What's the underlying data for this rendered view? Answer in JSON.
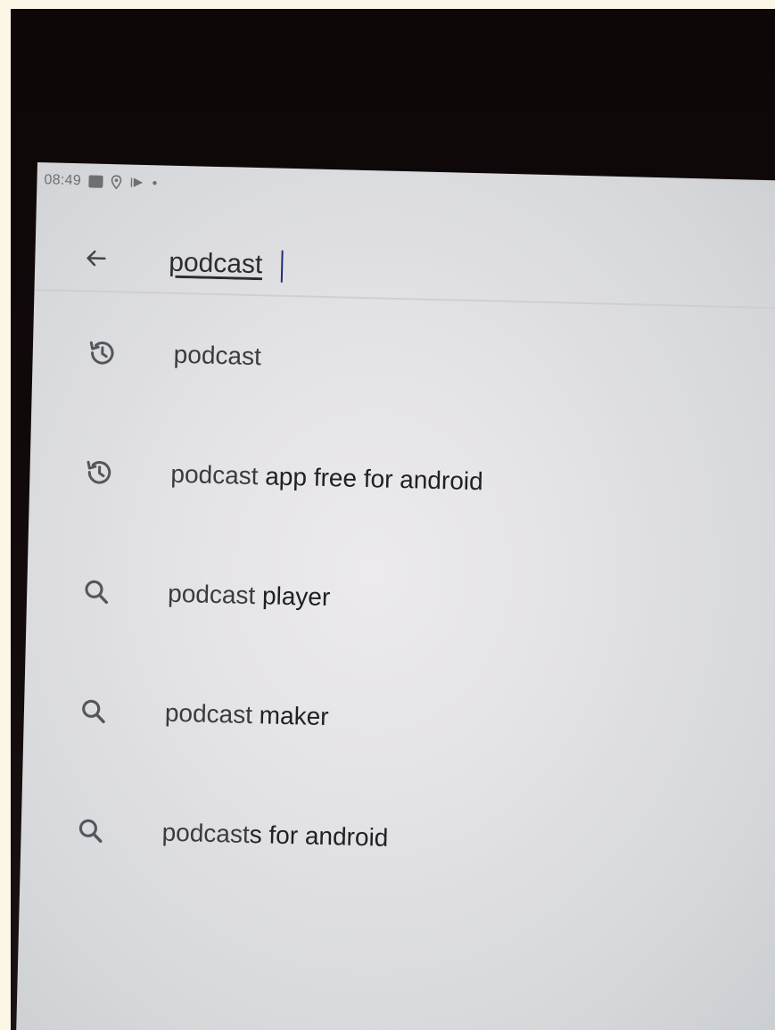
{
  "status_bar": {
    "time": "08:49",
    "icons": [
      "photo-icon",
      "location-icon",
      "cast-icon",
      "dot-icon"
    ]
  },
  "search": {
    "query": "podcast",
    "back_icon": "arrow-left-icon"
  },
  "suggestions": [
    {
      "icon": "history-icon",
      "match": "podcast",
      "rest": ""
    },
    {
      "icon": "history-icon",
      "match": "podcast",
      "rest": " app free for android"
    },
    {
      "icon": "search-icon",
      "match": "podcast",
      "rest": " player"
    },
    {
      "icon": "search-icon",
      "match": "podcast",
      "rest": " maker"
    },
    {
      "icon": "search-icon",
      "match": "podcast",
      "rest": "s for android"
    }
  ],
  "colors": {
    "icon": "#55565b",
    "text": "#202124",
    "background": "#e3e2e5"
  }
}
